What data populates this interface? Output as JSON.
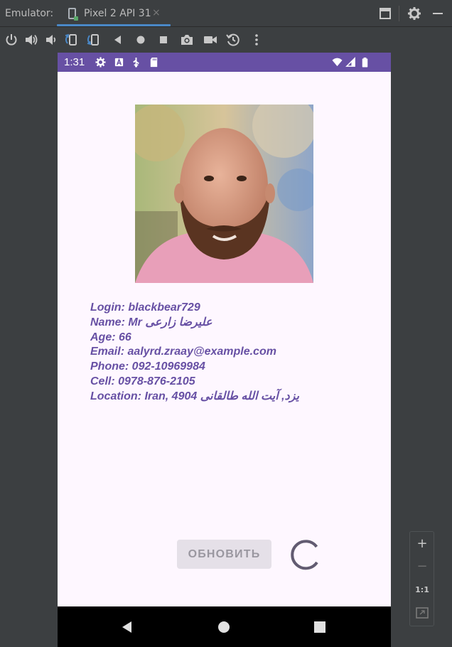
{
  "titlebar": {
    "label": "Emulator:",
    "tab_title": "Pixel 2 API 31",
    "tab_close": "×"
  },
  "toolbar": {
    "icons": [
      "power-icon",
      "volume-up-icon",
      "volume-down-icon",
      "rotate-left-icon",
      "rotate-right-icon",
      "back-icon",
      "home-icon",
      "overview-icon",
      "camera-icon",
      "video-icon",
      "snapshot-icon",
      "more-icon"
    ]
  },
  "status_bar": {
    "time": "1:31",
    "background": "#6750a4"
  },
  "profile": {
    "login": "Login: blackbear729",
    "name": "Name: Mr علیرضا زارعی",
    "age": "Age: 66",
    "email": "Email: aalyrd.zraay@example.com",
    "phone": "Phone: 092-10969984",
    "cell": "Cell: 0978-876-2105",
    "location": "Location: Iran, 4904 یزد, آیت الله طالقانی",
    "accent_color": "#6750a4"
  },
  "actions": {
    "refresh_label": "ОБНОВИТЬ"
  },
  "zoom": {
    "zoom_in": "+",
    "zoom_out": "−",
    "actual_size": "1:1"
  }
}
